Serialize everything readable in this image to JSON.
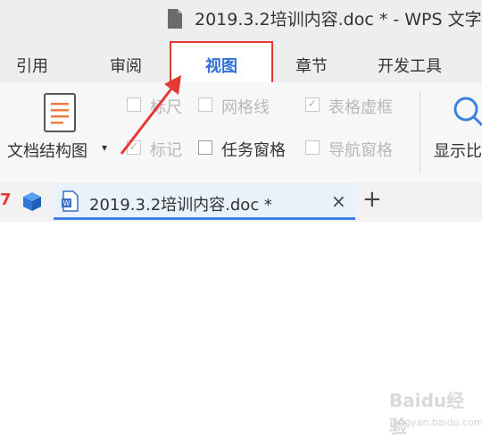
{
  "window": {
    "title": "2019.3.2培训内容.doc * - WPS 文字",
    "file_icon": "document-file-icon"
  },
  "menu_tabs": [
    "引用",
    "审阅",
    "视图",
    "章节",
    "开发工具"
  ],
  "active_tab": "视图",
  "ribbon": {
    "document_map_label": "文档结构图",
    "document_map_icon": "document-map-icon",
    "checkboxes": [
      {
        "label": "标尺",
        "checked": false
      },
      {
        "label": "网格线",
        "checked": false
      },
      {
        "label": "表格虚框",
        "checked": true
      },
      {
        "label": "标记",
        "checked": true
      },
      {
        "label": "任务窗格",
        "checked": false
      },
      {
        "label": "导航窗格",
        "checked": false
      }
    ],
    "zoom_label": "显示比",
    "zoom_icon": "magnifier-icon"
  },
  "doc_tabs": [
    {
      "title": "2019.3.2培训内容.doc *",
      "active": true
    }
  ],
  "doc_tab_close": "×",
  "new_tab_label": "+",
  "left_mark": "7",
  "watermark": {
    "logo": "Baidu经验",
    "url": "jingyan.baidu.com"
  },
  "colors": {
    "highlight_red": "#e53935",
    "active_blue": "#2f6fd8",
    "doc_tab_underline": "#3d82e0"
  }
}
